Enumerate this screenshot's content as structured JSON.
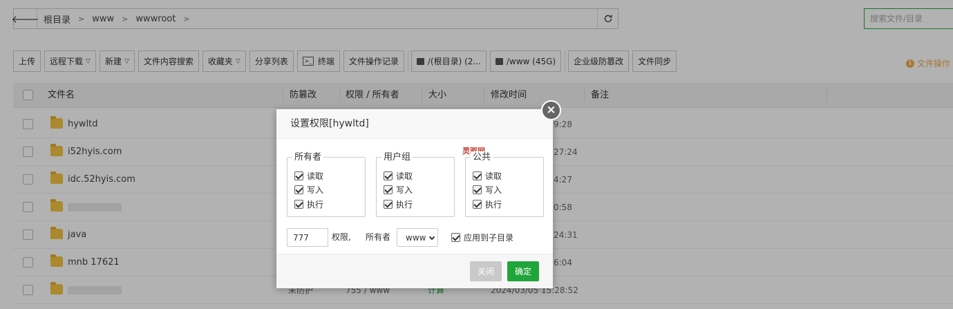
{
  "path": {
    "crumbs": [
      "根目录",
      "www",
      "wwwroot"
    ],
    "search_placeholder": "搜索文件/目录"
  },
  "toolbar": {
    "upload": "上传",
    "remote_download": "远程下载",
    "new": "新建",
    "content_search": "文件内容搜索",
    "favorites": "收藏夹",
    "share_list": "分享列表",
    "terminal": "终端",
    "op_log": "文件操作记录",
    "disk_root": "/(根目录) (2...",
    "disk_www": "/www (45G)",
    "tamper": "企业级防篡改",
    "sync": "文件同步",
    "hint": "文件操作"
  },
  "table": {
    "headers": {
      "name": "文件名",
      "tamper": "防篡改",
      "perm": "权限 / 所有者",
      "size": "大小",
      "mtime": "修改时间",
      "note": "备注"
    },
    "rows": [
      {
        "name": "hywltd",
        "tamper": "",
        "perm": "",
        "size": "",
        "mtime": "9:28"
      },
      {
        "name": "i52hyis.com",
        "tamper": "",
        "perm": "",
        "size": "",
        "mtime": "27:24"
      },
      {
        "name": "idc.52hyis.com",
        "tamper": "",
        "perm": "",
        "size": "",
        "mtime": "4:27"
      },
      {
        "name": "",
        "tamper": "",
        "perm": "",
        "size": "",
        "mtime": "0:58"
      },
      {
        "name": "java",
        "tamper": "",
        "perm": "",
        "size": "",
        "mtime": "24:31"
      },
      {
        "name": "mnb  17621",
        "tamper": "",
        "perm": "",
        "size": "",
        "mtime": "6:04"
      },
      {
        "name": "",
        "tamper": "未防护",
        "perm": "755 / www",
        "size": "计算",
        "mtime": "2024/03/05 15:28:52"
      }
    ]
  },
  "dialog": {
    "title": "设置权限[hywltd]",
    "groups": [
      {
        "label": "所有者",
        "perms": [
          "读取",
          "写入",
          "执行"
        ]
      },
      {
        "label": "用户组",
        "perms": [
          "读取",
          "写入",
          "执行"
        ]
      },
      {
        "label": "公共",
        "perms": [
          "读取",
          "写入",
          "执行"
        ]
      }
    ],
    "mode_value": "777",
    "perm_label": "权限,",
    "owner_label": "所有者",
    "owner_value": "www",
    "apply_sub_label": "应用到子目录",
    "close_button": "关闭",
    "ok_button": "确定",
    "watermark": "灵驱网"
  },
  "colors": {
    "accent": "#20a53a",
    "warning": "#f0ad4e"
  }
}
